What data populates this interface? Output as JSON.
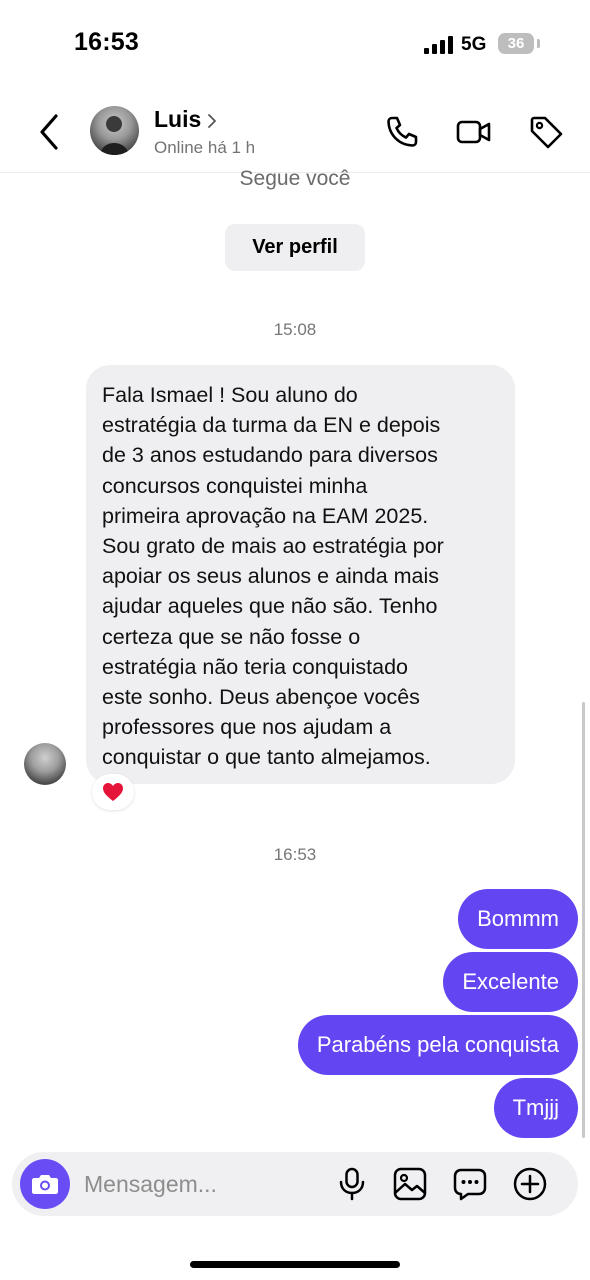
{
  "status_bar": {
    "time": "16:53",
    "network": "5G",
    "battery": "36"
  },
  "header": {
    "contact_name": "Luis",
    "contact_status": "Online há 1 h",
    "icons": [
      "back-icon",
      "phone-icon",
      "video-icon",
      "tag-icon"
    ]
  },
  "chat": {
    "profile_note": "Segue você",
    "view_profile_label": "Ver perfil",
    "timestamp_1": "15:08",
    "incoming_message": {
      "lines": [
        "Fala Ismael ! Sou aluno do",
        "estratégia da turma da EN e depois",
        "de 3 anos estudando para diversos",
        "concursos conquistei minha",
        "primeira aprovação na EAM 2025.",
        "Sou grato de mais ao estratégia por",
        "apoiar os seus alunos e ainda mais",
        "ajudar aqueles que não são. Tenho",
        "certeza que se não fosse o",
        "estratégia não teria conquistado",
        "este sonho. Deus abençoe vocês",
        "professores que nos ajudam a",
        "conquistar o que tanto almejamos."
      ],
      "reaction": "❤️"
    },
    "timestamp_2": "16:53",
    "outgoing_messages": [
      "Bommm",
      "Excelente",
      "Parabéns pela conquista",
      "Tmjjj"
    ]
  },
  "composer": {
    "placeholder": "Mensagem...",
    "icons": [
      "camera-icon",
      "microphone-icon",
      "image-icon",
      "sticker-icon",
      "plus-icon"
    ]
  },
  "colors": {
    "accent": "#6445F2",
    "incoming_bubble": "#EFEFF1"
  }
}
